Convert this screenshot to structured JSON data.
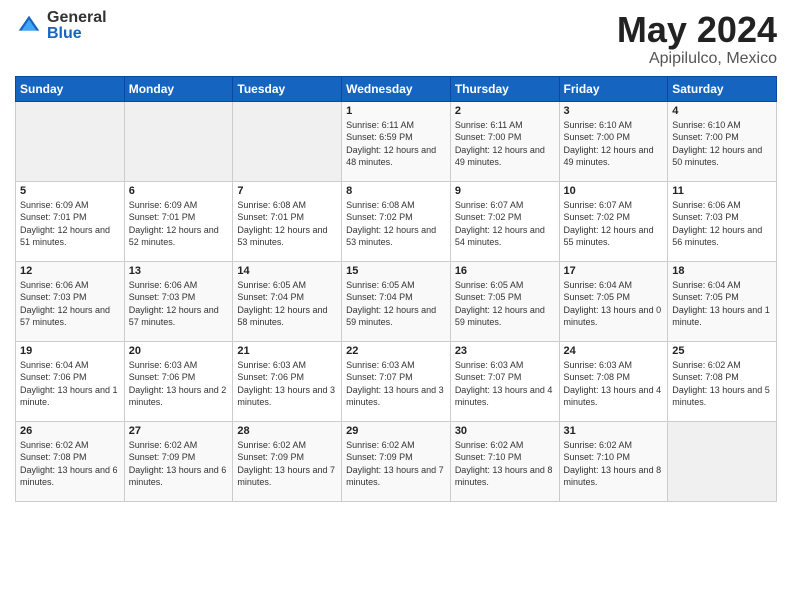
{
  "logo": {
    "general": "General",
    "blue": "Blue"
  },
  "header": {
    "month_year": "May 2024",
    "location": "Apipilulco, Mexico"
  },
  "weekdays": [
    "Sunday",
    "Monday",
    "Tuesday",
    "Wednesday",
    "Thursday",
    "Friday",
    "Saturday"
  ],
  "weeks": [
    [
      {
        "day": "",
        "sunrise": "",
        "sunset": "",
        "daylight": ""
      },
      {
        "day": "",
        "sunrise": "",
        "sunset": "",
        "daylight": ""
      },
      {
        "day": "",
        "sunrise": "",
        "sunset": "",
        "daylight": ""
      },
      {
        "day": "1",
        "sunrise": "Sunrise: 6:11 AM",
        "sunset": "Sunset: 6:59 PM",
        "daylight": "Daylight: 12 hours and 48 minutes."
      },
      {
        "day": "2",
        "sunrise": "Sunrise: 6:11 AM",
        "sunset": "Sunset: 7:00 PM",
        "daylight": "Daylight: 12 hours and 49 minutes."
      },
      {
        "day": "3",
        "sunrise": "Sunrise: 6:10 AM",
        "sunset": "Sunset: 7:00 PM",
        "daylight": "Daylight: 12 hours and 49 minutes."
      },
      {
        "day": "4",
        "sunrise": "Sunrise: 6:10 AM",
        "sunset": "Sunset: 7:00 PM",
        "daylight": "Daylight: 12 hours and 50 minutes."
      }
    ],
    [
      {
        "day": "5",
        "sunrise": "Sunrise: 6:09 AM",
        "sunset": "Sunset: 7:01 PM",
        "daylight": "Daylight: 12 hours and 51 minutes."
      },
      {
        "day": "6",
        "sunrise": "Sunrise: 6:09 AM",
        "sunset": "Sunset: 7:01 PM",
        "daylight": "Daylight: 12 hours and 52 minutes."
      },
      {
        "day": "7",
        "sunrise": "Sunrise: 6:08 AM",
        "sunset": "Sunset: 7:01 PM",
        "daylight": "Daylight: 12 hours and 53 minutes."
      },
      {
        "day": "8",
        "sunrise": "Sunrise: 6:08 AM",
        "sunset": "Sunset: 7:02 PM",
        "daylight": "Daylight: 12 hours and 53 minutes."
      },
      {
        "day": "9",
        "sunrise": "Sunrise: 6:07 AM",
        "sunset": "Sunset: 7:02 PM",
        "daylight": "Daylight: 12 hours and 54 minutes."
      },
      {
        "day": "10",
        "sunrise": "Sunrise: 6:07 AM",
        "sunset": "Sunset: 7:02 PM",
        "daylight": "Daylight: 12 hours and 55 minutes."
      },
      {
        "day": "11",
        "sunrise": "Sunrise: 6:06 AM",
        "sunset": "Sunset: 7:03 PM",
        "daylight": "Daylight: 12 hours and 56 minutes."
      }
    ],
    [
      {
        "day": "12",
        "sunrise": "Sunrise: 6:06 AM",
        "sunset": "Sunset: 7:03 PM",
        "daylight": "Daylight: 12 hours and 57 minutes."
      },
      {
        "day": "13",
        "sunrise": "Sunrise: 6:06 AM",
        "sunset": "Sunset: 7:03 PM",
        "daylight": "Daylight: 12 hours and 57 minutes."
      },
      {
        "day": "14",
        "sunrise": "Sunrise: 6:05 AM",
        "sunset": "Sunset: 7:04 PM",
        "daylight": "Daylight: 12 hours and 58 minutes."
      },
      {
        "day": "15",
        "sunrise": "Sunrise: 6:05 AM",
        "sunset": "Sunset: 7:04 PM",
        "daylight": "Daylight: 12 hours and 59 minutes."
      },
      {
        "day": "16",
        "sunrise": "Sunrise: 6:05 AM",
        "sunset": "Sunset: 7:05 PM",
        "daylight": "Daylight: 12 hours and 59 minutes."
      },
      {
        "day": "17",
        "sunrise": "Sunrise: 6:04 AM",
        "sunset": "Sunset: 7:05 PM",
        "daylight": "Daylight: 13 hours and 0 minutes."
      },
      {
        "day": "18",
        "sunrise": "Sunrise: 6:04 AM",
        "sunset": "Sunset: 7:05 PM",
        "daylight": "Daylight: 13 hours and 1 minute."
      }
    ],
    [
      {
        "day": "19",
        "sunrise": "Sunrise: 6:04 AM",
        "sunset": "Sunset: 7:06 PM",
        "daylight": "Daylight: 13 hours and 1 minute."
      },
      {
        "day": "20",
        "sunrise": "Sunrise: 6:03 AM",
        "sunset": "Sunset: 7:06 PM",
        "daylight": "Daylight: 13 hours and 2 minutes."
      },
      {
        "day": "21",
        "sunrise": "Sunrise: 6:03 AM",
        "sunset": "Sunset: 7:06 PM",
        "daylight": "Daylight: 13 hours and 3 minutes."
      },
      {
        "day": "22",
        "sunrise": "Sunrise: 6:03 AM",
        "sunset": "Sunset: 7:07 PM",
        "daylight": "Daylight: 13 hours and 3 minutes."
      },
      {
        "day": "23",
        "sunrise": "Sunrise: 6:03 AM",
        "sunset": "Sunset: 7:07 PM",
        "daylight": "Daylight: 13 hours and 4 minutes."
      },
      {
        "day": "24",
        "sunrise": "Sunrise: 6:03 AM",
        "sunset": "Sunset: 7:08 PM",
        "daylight": "Daylight: 13 hours and 4 minutes."
      },
      {
        "day": "25",
        "sunrise": "Sunrise: 6:02 AM",
        "sunset": "Sunset: 7:08 PM",
        "daylight": "Daylight: 13 hours and 5 minutes."
      }
    ],
    [
      {
        "day": "26",
        "sunrise": "Sunrise: 6:02 AM",
        "sunset": "Sunset: 7:08 PM",
        "daylight": "Daylight: 13 hours and 6 minutes."
      },
      {
        "day": "27",
        "sunrise": "Sunrise: 6:02 AM",
        "sunset": "Sunset: 7:09 PM",
        "daylight": "Daylight: 13 hours and 6 minutes."
      },
      {
        "day": "28",
        "sunrise": "Sunrise: 6:02 AM",
        "sunset": "Sunset: 7:09 PM",
        "daylight": "Daylight: 13 hours and 7 minutes."
      },
      {
        "day": "29",
        "sunrise": "Sunrise: 6:02 AM",
        "sunset": "Sunset: 7:09 PM",
        "daylight": "Daylight: 13 hours and 7 minutes."
      },
      {
        "day": "30",
        "sunrise": "Sunrise: 6:02 AM",
        "sunset": "Sunset: 7:10 PM",
        "daylight": "Daylight: 13 hours and 8 minutes."
      },
      {
        "day": "31",
        "sunrise": "Sunrise: 6:02 AM",
        "sunset": "Sunset: 7:10 PM",
        "daylight": "Daylight: 13 hours and 8 minutes."
      },
      {
        "day": "",
        "sunrise": "",
        "sunset": "",
        "daylight": ""
      }
    ]
  ]
}
